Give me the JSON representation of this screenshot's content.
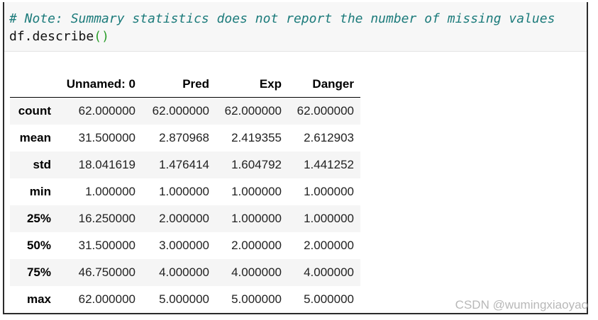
{
  "code": {
    "comment": "# Note: Summary statistics does not report the number of missing values",
    "call_prefix": "df.describe",
    "open_paren": "(",
    "close_paren": ")"
  },
  "table": {
    "columns": [
      "",
      "Unnamed: 0",
      "Pred",
      "Exp",
      "Danger"
    ],
    "rows": [
      {
        "index": "count",
        "values": [
          "62.000000",
          "62.000000",
          "62.000000",
          "62.000000"
        ]
      },
      {
        "index": "mean",
        "values": [
          "31.500000",
          "2.870968",
          "2.419355",
          "2.612903"
        ]
      },
      {
        "index": "std",
        "values": [
          "18.041619",
          "1.476414",
          "1.604792",
          "1.441252"
        ]
      },
      {
        "index": "min",
        "values": [
          "1.000000",
          "1.000000",
          "1.000000",
          "1.000000"
        ]
      },
      {
        "index": "25%",
        "values": [
          "16.250000",
          "2.000000",
          "1.000000",
          "1.000000"
        ]
      },
      {
        "index": "50%",
        "values": [
          "31.500000",
          "3.000000",
          "2.000000",
          "2.000000"
        ]
      },
      {
        "index": "75%",
        "values": [
          "46.750000",
          "4.000000",
          "4.000000",
          "4.000000"
        ]
      },
      {
        "index": "max",
        "values": [
          "62.000000",
          "5.000000",
          "5.000000",
          "5.000000"
        ]
      }
    ]
  },
  "watermark": "CSDN @wumingxiaoyao"
}
